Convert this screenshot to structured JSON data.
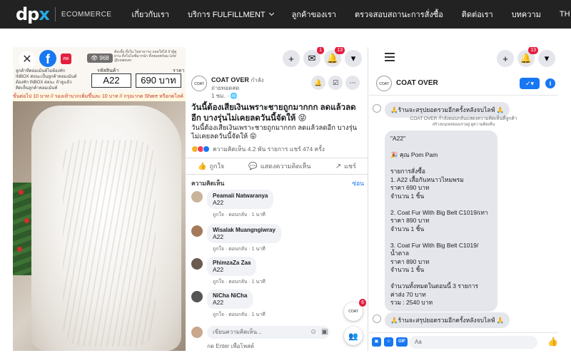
{
  "nav": {
    "logo_main": "dp",
    "logo_x": "x",
    "logo_sub": "ECOMMERCE",
    "items": [
      {
        "label": "เกี่ยวกับเรา"
      },
      {
        "label": "บริการ FULFILLMENT"
      },
      {
        "label": "ลูกค้าของเรา"
      },
      {
        "label": "ตรวจสอบสถานะการสั่งซื้อ"
      },
      {
        "label": "ติดต่อเรา"
      },
      {
        "label": "บทความ"
      },
      {
        "label": "TH"
      }
    ]
  },
  "video": {
    "close": "✕",
    "fb": "f",
    "live_tag": "สด",
    "viewers": "968",
    "promo_left": "ลูกค้าที่คอมเม้นต์ไม่ต้องทัก INBOX ค่อนะเป็นลูกค้าคอมเม้นต์ต้องทัก INBOX ค่อนะ ถ้าดูแล้วคิดเห็นลูกค้าคอมเม้นท์",
    "promo_right": "ต้องลิ้ง ทั้งใน ไม่สามารถ ถอดใส่ได้ ถ้าผู้ดูผ่าน ทั้งในไลฟ์มากนัก ทั้งหมดพร้อม Line @coatover",
    "code_label": "รหัสสินค้า",
    "price_label": "ราคา",
    "code": "A22",
    "price": "690 บาท",
    "ticker": "ขั้นต่อไป 10 บาท // รองเท้าบวกเพิ่มขึ้นละ 10 บาท // กรุณากด Share หรือกดไลค์"
  },
  "post": {
    "messenger_badge": "1",
    "notif_badge": "13",
    "page_name": "COAT OVER",
    "page_live": "กำลัง",
    "page_sub": "ถ่ายทอดสด",
    "time": "1 ชม. · 🌐",
    "title": "วันนี้ต้องเสียเงินเพราะชายถูกมากกก ลดแล้วลดอีก บางรุ่นไม่เคยลดวันนี้จัดให้ 😝",
    "body": "วันนี้ต้องเสียเงินเพราะชายถูกมากกก ลดแล้วลดอีก บางรุ่นไม่เคยลดวันนี้จัดให้ 😝",
    "reactions": "ความคิดเห็น 4.2 พัน รายการ  แชร์ 474 ครั้ง",
    "like": "ถูกใจ",
    "comment": "แสดงความคิดเห็น",
    "share": "แชร์",
    "comments_label": "ความคิดเห็น",
    "hide": "ซ่อน",
    "comments": [
      {
        "name": "Peamaii Natwaranya",
        "text": "A22",
        "meta": "ถูกใจ · ตอบกลับ · 1 นาที"
      },
      {
        "name": "Wisalak Muangngiwray",
        "text": "A22",
        "meta": "ถูกใจ · ตอบกลับ · 1 นาที"
      },
      {
        "name": "PhimzaZa Zaa",
        "text": "A22",
        "meta": "ถูกใจ · ตอบกลับ · 1 นาที"
      },
      {
        "name": "NiCha NiCha",
        "text": "A22",
        "meta": "ถูกใจ · ตอบกลับ · 1 นาที"
      }
    ],
    "input_placeholder": "เขียนความคิดเห็น...",
    "enter_hint": "กด Enter เพื่อโพสต์",
    "float_badge": "6"
  },
  "messenger": {
    "notif_badge": "13",
    "name": "COAT OVER",
    "check": "✓▾",
    "info": "i",
    "first_msg": "🙏ร้านจะสรุปยอดรวมอีกครั้งหลังจบไลฟ์ 🙏",
    "sys_line1": "COAT OVER กำลังตอบกลับแสดงความคิดเห็นที่ลูกค้า",
    "sys_line2": "สร้างบนเพจของเราอยู่ ดูความคิดเห็น",
    "order_lines": [
      "\"A22\"",
      "",
      "🎉 คุณ Pom Pam",
      "",
      "รายการสั่งซื้อ",
      "1. A22 เสื้อกันหนาวไหมพรม",
      "ราคา 690 บาท",
      "จำนวน 1 ชิ้น",
      "",
      "2. Coat Fur With Big Belt C1019/เทา",
      "ราคา 890 บาท",
      "จำนวน 1 ชิ้น",
      "",
      "3. Coat Fur With Big Belt C1019/น้ำตาล",
      "ราคา 890 บาท",
      "จำนวน 1 ชิ้น",
      "",
      "จำนวนทั้งหมดในตอนนี้ 3 รายการ",
      "ค่าส่ง 70 บาท",
      "รวม : 2540 บาท"
    ],
    "last_msg": "🙏ร้านจะสรุปยอดรวมอีกครั้งหลังจบไลฟ์ 🙏",
    "input_placeholder": "Aa",
    "gif": "GIF"
  }
}
